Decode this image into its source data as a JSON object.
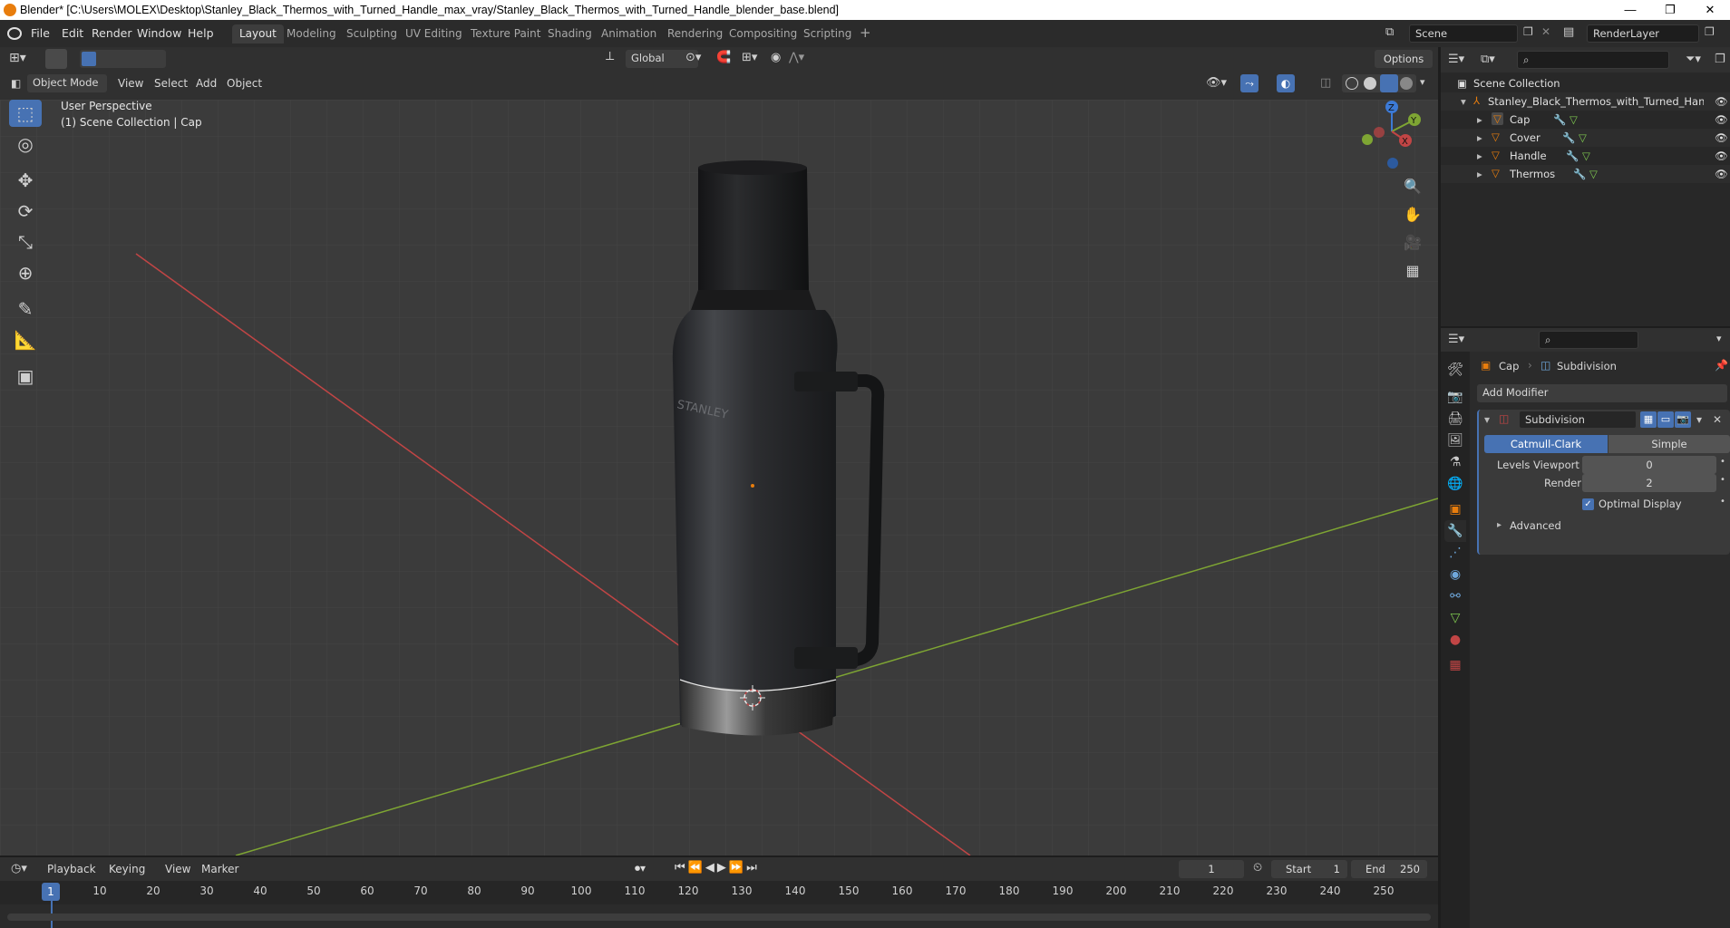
{
  "title_bar": {
    "title": "Blender* [C:\\Users\\MOLEX\\Desktop\\Stanley_Black_Thermos_with_Turned_Handle_max_vray/Stanley_Black_Thermos_with_Turned_Handle_blender_base.blend]",
    "minimize": "—",
    "maximize": "❐",
    "close": "✕"
  },
  "menu": {
    "items": [
      "File",
      "Edit",
      "Render",
      "Window",
      "Help"
    ],
    "workspaces": [
      "Layout",
      "Modeling",
      "Sculpting",
      "UV Editing",
      "Texture Paint",
      "Shading",
      "Animation",
      "Rendering",
      "Compositing",
      "Scripting"
    ],
    "active_workspace": "Layout",
    "add_tab": "+",
    "scene": "Scene",
    "view_layer": "RenderLayer"
  },
  "viewport_header": {
    "transform_orientation": "Global",
    "options": "Options",
    "mode": "Object Mode",
    "menus": [
      "View",
      "Select",
      "Add",
      "Object"
    ]
  },
  "viewport": {
    "perspective": "User Perspective",
    "collection_info": "(1) Scene Collection | Cap",
    "gizmo_axes": [
      "X",
      "Y",
      "Z"
    ],
    "tools": [
      "select-box",
      "cursor",
      "move",
      "rotate",
      "scale",
      "transform",
      "annotate",
      "measure",
      "add-cube"
    ],
    "nav_buttons": [
      "zoom",
      "pan",
      "camera",
      "perspective-toggle"
    ],
    "logo_text": "STANLEY"
  },
  "outliner": {
    "root": "Scene Collection",
    "collection": "Stanley_Black_Thermos_with_Turned_Handle",
    "objects": [
      "Cap",
      "Cover",
      "Handle",
      "Thermos"
    ]
  },
  "properties": {
    "breadcrumb_object": "Cap",
    "breadcrumb_modifier": "Subdivision",
    "add_modifier": "Add Modifier",
    "modifier": {
      "name": "Subdivision",
      "type_options": [
        "Catmull-Clark",
        "Simple"
      ],
      "active_type": "Catmull-Clark",
      "levels_viewport_label": "Levels Viewport",
      "levels_viewport": "0",
      "render_label": "Render",
      "render": "2",
      "optimal_display_label": "Optimal Display",
      "optimal_display": true,
      "advanced_label": "Advanced"
    }
  },
  "timeline": {
    "menus": [
      "Playback",
      "Keying",
      "View",
      "Marker"
    ],
    "current_frame": "1",
    "start_label": "Start",
    "start": "1",
    "end_label": "End",
    "end": "250",
    "ticks": [
      "1",
      "10",
      "20",
      "30",
      "40",
      "50",
      "60",
      "70",
      "80",
      "90",
      "100",
      "110",
      "120",
      "130",
      "140",
      "150",
      "160",
      "170",
      "180",
      "190",
      "200",
      "210",
      "220",
      "230",
      "240",
      "250"
    ]
  },
  "colors": {
    "accent": "#4772b3",
    "active_object": "#e87d0d",
    "x_axis": "#c14545",
    "y_axis": "#7ea533",
    "z_axis": "#3c7ad6"
  }
}
